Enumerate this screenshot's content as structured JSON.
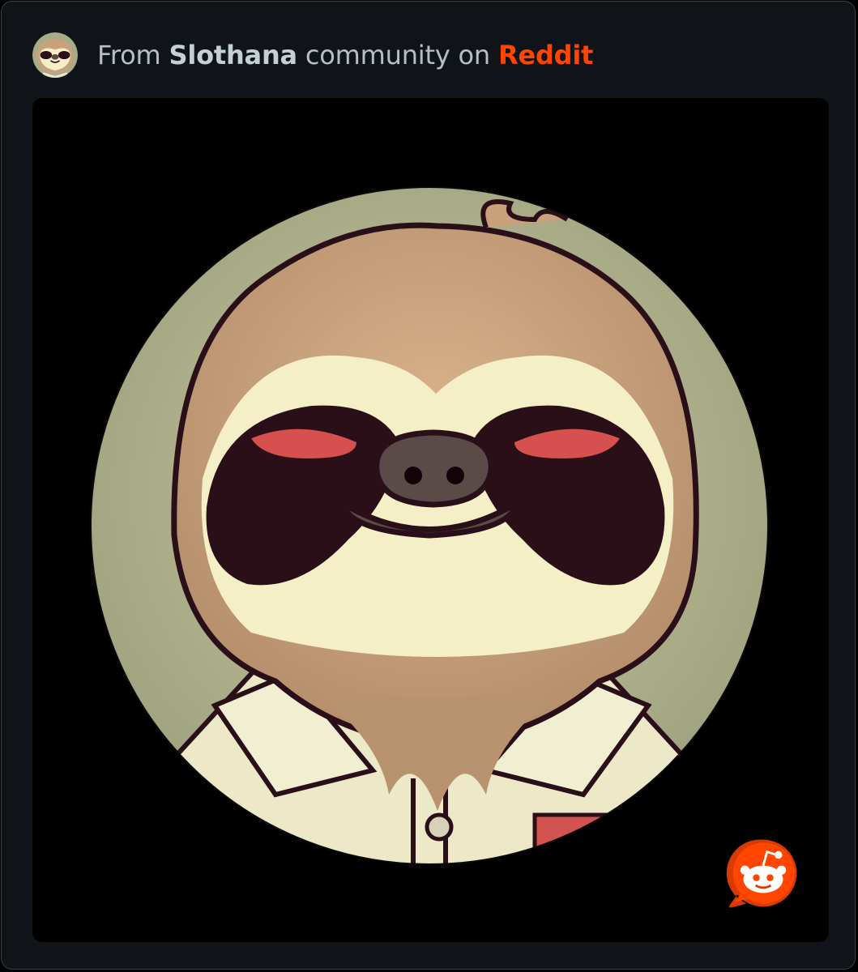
{
  "header": {
    "prefix": "From",
    "community": "Slothana",
    "middle": "community",
    "on": "on",
    "platform": "Reddit"
  },
  "colors": {
    "card_background": "#101418",
    "accent": "#ff4500",
    "muted_text": "#b4bfc6",
    "sloth_fur": "#c9a27c",
    "sloth_face": "#f4efc6",
    "avatar_background": "#a8ab8a"
  },
  "media": {
    "icon": "sloth-avatar-icon",
    "badge_icon": "reddit-logo-icon"
  }
}
